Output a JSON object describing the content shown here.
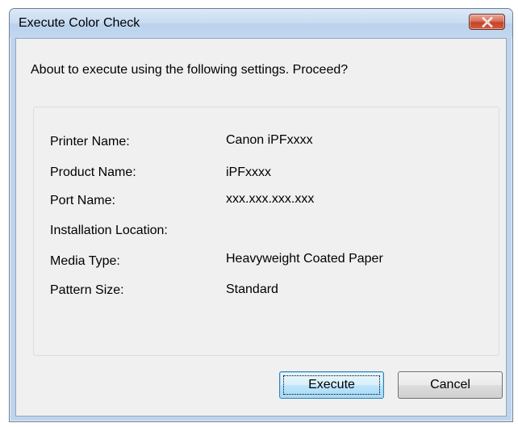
{
  "window": {
    "title": "Execute Color Check"
  },
  "dialog": {
    "prompt": "About to execute using the following settings. Proceed?",
    "settings": [
      {
        "label": "Printer Name:",
        "value": "Canon iPFxxxx"
      },
      {
        "label": "Product Name:",
        "value": "iPFxxxx"
      },
      {
        "label": "Port Name:",
        "value": "xxx.xxx.xxx.xxx"
      },
      {
        "label": "Installation Location:",
        "value": ""
      },
      {
        "label": "Media Type:",
        "value": "Heavyweight Coated Paper"
      },
      {
        "label": "Pattern Size:",
        "value": "Standard"
      }
    ]
  },
  "buttons": {
    "execute_label": "Execute",
    "cancel_label": "Cancel"
  },
  "icons": {
    "close": "close-icon"
  },
  "colors": {
    "close_button": "#c4432b",
    "default_button_border": "#3c7fb1",
    "title_bar": "#c7dbf1"
  }
}
